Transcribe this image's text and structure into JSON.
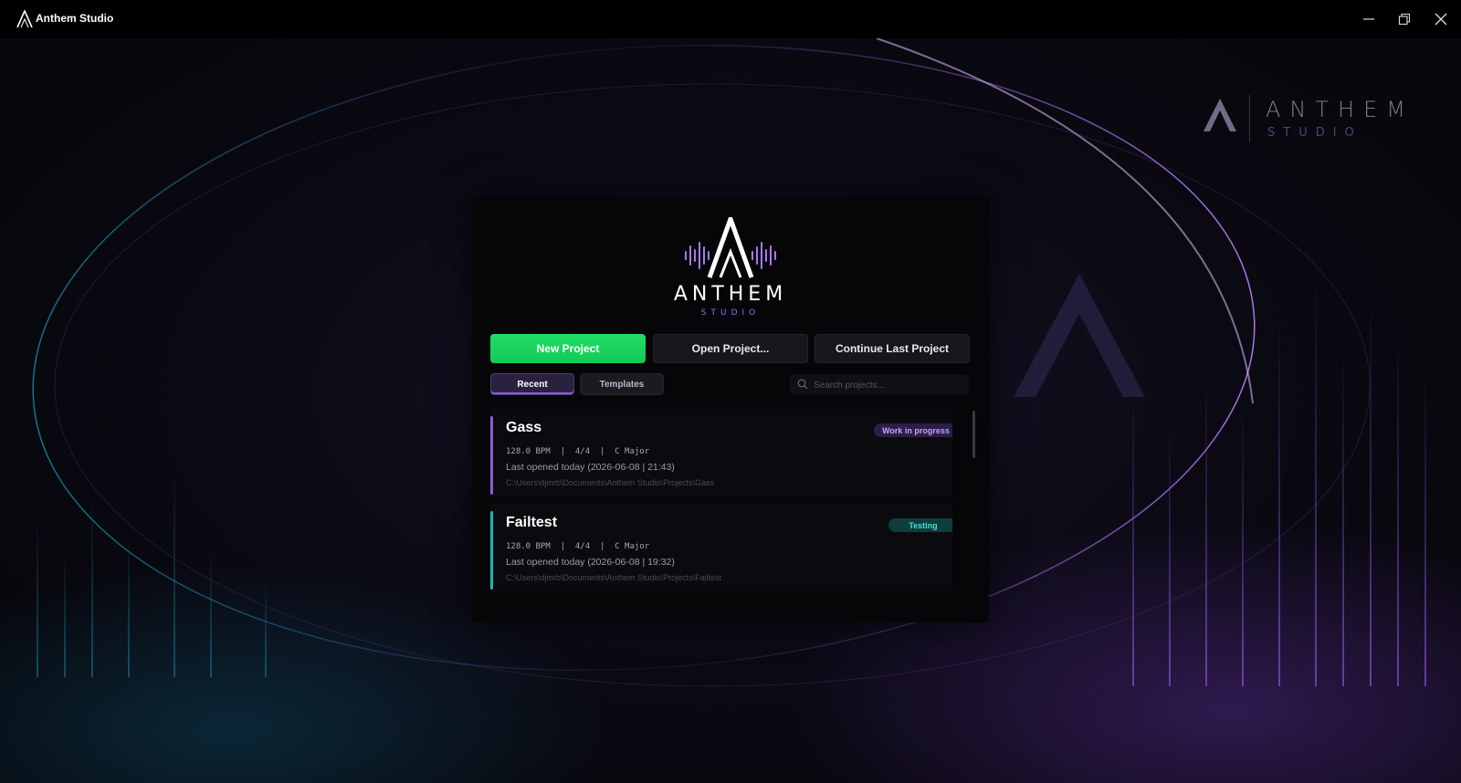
{
  "window": {
    "title": "Anthem Studio",
    "controls": [
      "minimize",
      "restore",
      "close"
    ]
  },
  "corner_brand": {
    "name": "ANTHEM",
    "sub": "STUDIO"
  },
  "logo": {
    "word": "ANTHEM",
    "sub": "STUDIO"
  },
  "actions": {
    "new_project": "New Project",
    "open_project": "Open Project...",
    "continue_last": "Continue Last Project"
  },
  "tabs": {
    "recent": "Recent",
    "templates": "Templates",
    "active": "Recent"
  },
  "search": {
    "placeholder": "Search projects..."
  },
  "projects": [
    {
      "name": "Gass",
      "meta": "128.0 BPM  |  4/4  |  C Major",
      "opened": "Last opened today (2026-06-08 | 21:43)",
      "path": "C:\\Users\\djmrb\\Documents\\Anthem Studio\\Projects\\Gass",
      "status": "Work in progress",
      "accent": "#8b5cd6"
    },
    {
      "name": "Failtest",
      "meta": "128.0 BPM  |  4/4  |  C Major",
      "opened": "Last opened today (2026-06-08 | 19:32)",
      "path": "C:\\Users\\djmrb\\Documents\\Anthem Studio\\Projects\\Failtest",
      "status": "Testing",
      "accent": "#1fb3b3"
    }
  ],
  "colors": {
    "primary": "#1ed760",
    "accent_purple": "#8b5cd6",
    "accent_teal": "#1fb3b3"
  }
}
